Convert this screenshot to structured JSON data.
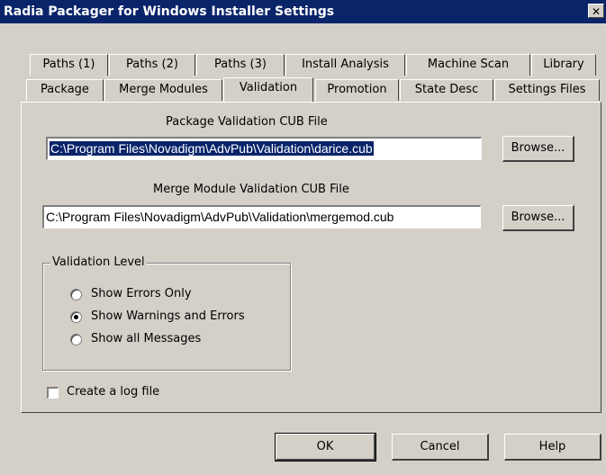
{
  "window": {
    "title": "Radia Packager for Windows Installer Settings",
    "close_glyph": "✕"
  },
  "tabs_row1": [
    {
      "label": "Paths (1)"
    },
    {
      "label": "Paths (2)"
    },
    {
      "label": "Paths (3)"
    },
    {
      "label": "Install Analysis"
    },
    {
      "label": "Machine Scan"
    },
    {
      "label": "Library"
    }
  ],
  "tabs_row2": [
    {
      "label": "Package"
    },
    {
      "label": "Merge Modules"
    },
    {
      "label": "Validation",
      "active": true
    },
    {
      "label": "Promotion"
    },
    {
      "label": "State Desc"
    },
    {
      "label": "Settings Files"
    }
  ],
  "validation": {
    "package_cub_label": "Package Validation CUB File",
    "package_cub_value": "C:\\Program Files\\Novadigm\\AdvPub\\Validation\\darice.cub",
    "merge_cub_label": "Merge Module Validation CUB File",
    "merge_cub_value": "C:\\Program Files\\Novadigm\\AdvPub\\Validation\\mergemod.cub",
    "browse_label": "Browse...",
    "level_group_label": "Validation Level",
    "levels": [
      {
        "label": "Show Errors Only",
        "selected": false
      },
      {
        "label": "Show Warnings and Errors",
        "selected": true
      },
      {
        "label": "Show all Messages",
        "selected": false
      }
    ],
    "log_label": "Create a log file",
    "log_checked": false
  },
  "footer": {
    "ok_label": "OK",
    "cancel_label": "Cancel",
    "help_label": "Help"
  }
}
